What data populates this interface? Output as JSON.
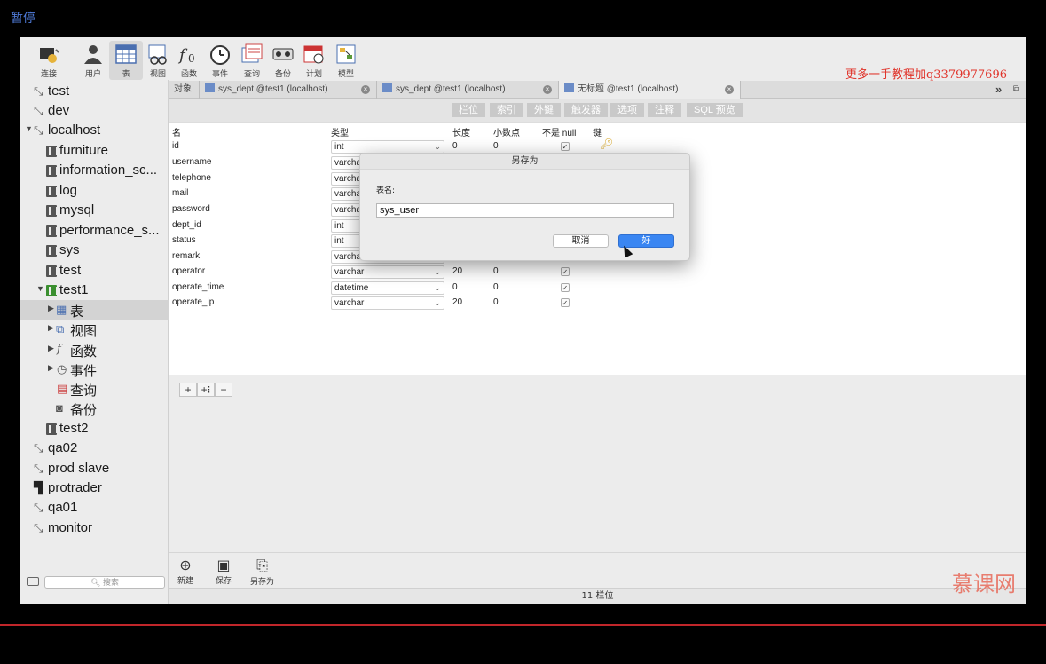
{
  "overlay": {
    "pause_label": "暂停",
    "watermark": "更多一手教程加q3379977696",
    "logo": "慕课网"
  },
  "toolbar": [
    {
      "label": "连接",
      "icon": "connection-icon"
    },
    {
      "label": "用户",
      "icon": "user-icon"
    },
    {
      "label": "表",
      "icon": "table-icon",
      "active": true
    },
    {
      "label": "视图",
      "icon": "view-icon"
    },
    {
      "label": "函数",
      "icon": "function-icon"
    },
    {
      "label": "事件",
      "icon": "event-icon"
    },
    {
      "label": "查询",
      "icon": "query-icon"
    },
    {
      "label": "备份",
      "icon": "backup-icon"
    },
    {
      "label": "计划",
      "icon": "schedule-icon"
    },
    {
      "label": "模型",
      "icon": "model-icon"
    }
  ],
  "sidebar": {
    "items": [
      {
        "label": "test"
      },
      {
        "label": "dev"
      },
      {
        "label": "localhost"
      },
      {
        "label": "furniture"
      },
      {
        "label": "information_sc..."
      },
      {
        "label": "log"
      },
      {
        "label": "mysql"
      },
      {
        "label": "performance_s..."
      },
      {
        "label": "sys"
      },
      {
        "label": "test"
      },
      {
        "label": "test1"
      },
      {
        "label": "表"
      },
      {
        "label": "视图"
      },
      {
        "label": "函数"
      },
      {
        "label": "事件"
      },
      {
        "label": "查询"
      },
      {
        "label": "备份"
      },
      {
        "label": "test2"
      },
      {
        "label": "qa02"
      },
      {
        "label": "prod slave"
      },
      {
        "label": "protrader"
      },
      {
        "label": "qa01"
      },
      {
        "label": "monitor"
      }
    ],
    "search_placeholder": "搜索"
  },
  "tabs": {
    "objects": "对象",
    "tab1": "sys_dept @test1 (localhost)",
    "tab2": "sys_dept @test1 (localhost)",
    "tab3": "无标题 @test1 (localhost)",
    "more": "»"
  },
  "subtabs": [
    "栏位",
    "索引",
    "外键",
    "触发器",
    "选项",
    "注释",
    "SQL 预览"
  ],
  "columns": {
    "name": "名",
    "type": "类型",
    "length": "长度",
    "decimals": "小数点",
    "notnull": "不是 null",
    "key": "键"
  },
  "rows": [
    {
      "name": "id",
      "type": "int",
      "length": "0",
      "decimals": "0",
      "notnull": "✓"
    },
    {
      "name": "username",
      "type": "varchar",
      "length": "",
      "decimals": "",
      "notnull": ""
    },
    {
      "name": "telephone",
      "type": "varchar",
      "length": "",
      "decimals": "",
      "notnull": ""
    },
    {
      "name": "mail",
      "type": "varchar",
      "length": "",
      "decimals": "",
      "notnull": ""
    },
    {
      "name": "password",
      "type": "varchar",
      "length": "",
      "decimals": "",
      "notnull": ""
    },
    {
      "name": "dept_id",
      "type": "int",
      "length": "",
      "decimals": "",
      "notnull": ""
    },
    {
      "name": "status",
      "type": "int",
      "length": "",
      "decimals": "",
      "notnull": ""
    },
    {
      "name": "remark",
      "type": "varchar",
      "length": "",
      "decimals": "",
      "notnull": ""
    },
    {
      "name": "operator",
      "type": "varchar",
      "length": "20",
      "decimals": "0",
      "notnull": "✓"
    },
    {
      "name": "operate_time",
      "type": "datetime",
      "length": "0",
      "decimals": "0",
      "notnull": "✓"
    },
    {
      "name": "operate_ip",
      "type": "varchar",
      "length": "20",
      "decimals": "0",
      "notnull": "✓"
    }
  ],
  "grid_buttons": [
    "+",
    "+⁝",
    "−"
  ],
  "footer": {
    "new": "新建",
    "save": "保存",
    "save_as": "另存为",
    "status": "11 栏位"
  },
  "dialog": {
    "title": "另存为",
    "label": "表名:",
    "value": "sys_user",
    "cancel": "取消",
    "ok": "好"
  }
}
